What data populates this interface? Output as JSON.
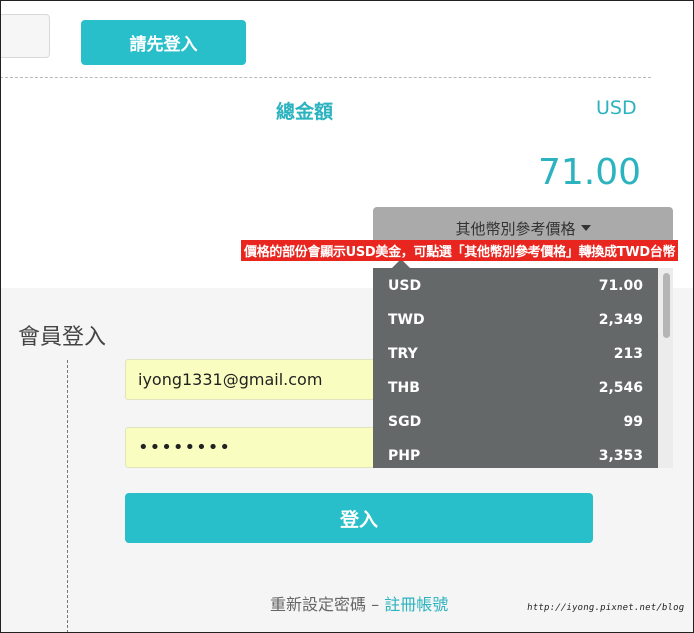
{
  "header": {
    "login_first_label": "請先登入"
  },
  "summary": {
    "total_label": "總金額",
    "currency": "USD",
    "amount": "71.00"
  },
  "currency_dropdown": {
    "button_label": "其他幣別參考價格",
    "rates": [
      {
        "code": "USD",
        "value": "71.00"
      },
      {
        "code": "TWD",
        "value": "2,349"
      },
      {
        "code": "TRY",
        "value": "213"
      },
      {
        "code": "THB",
        "value": "2,546"
      },
      {
        "code": "SGD",
        "value": "99"
      },
      {
        "code": "PHP",
        "value": "3,353"
      }
    ]
  },
  "annotation": "價格的部份會顯示USD美金，可點選「其他幣別參考價格」轉換成TWD台幣",
  "member_login": {
    "title": "會員登入",
    "email_value": "iyong1331@gmail.com",
    "password_value": "••••••••",
    "login_label": "登入",
    "reset_label": "重新設定密碼",
    "separator": " – ",
    "register_label": "註冊帳號"
  },
  "watermark": "http://iyong.pixnet.net/blog",
  "colors": {
    "accent": "#29bfca",
    "dropdown_bg": "#646868",
    "annotation_bg": "#e8261f"
  }
}
